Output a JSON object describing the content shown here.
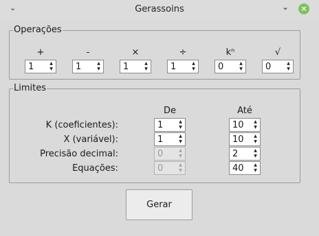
{
  "window": {
    "title": "Gerassoins"
  },
  "operacoes": {
    "legend": "Operações",
    "items": [
      {
        "symbol": "+",
        "value": "1"
      },
      {
        "symbol": "-",
        "value": "1"
      },
      {
        "symbol": "×",
        "value": "1"
      },
      {
        "symbol": "÷",
        "value": "1"
      },
      {
        "symbol": "kⁿ",
        "value": "0"
      },
      {
        "symbol": "√",
        "value": "0"
      }
    ]
  },
  "limites": {
    "legend": "Limites",
    "col_de": "De",
    "col_ate": "Até",
    "rows": [
      {
        "label": "K (coeficientes):",
        "de": "1",
        "ate": "10",
        "de_enabled": true
      },
      {
        "label": "X (variável):",
        "de": "1",
        "ate": "10",
        "de_enabled": true
      },
      {
        "label": "Precisão decimal:",
        "de": "0",
        "ate": "2",
        "de_enabled": false
      },
      {
        "label": "Equações:",
        "de": "0",
        "ate": "40",
        "de_enabled": false
      }
    ]
  },
  "gerar_label": "Gerar",
  "icons": {
    "menu": "chevron-down-icon",
    "minimize": "minimize-icon",
    "close": "close-icon"
  },
  "colors": {
    "close_button": "#7fc160",
    "background": "#dadada"
  }
}
